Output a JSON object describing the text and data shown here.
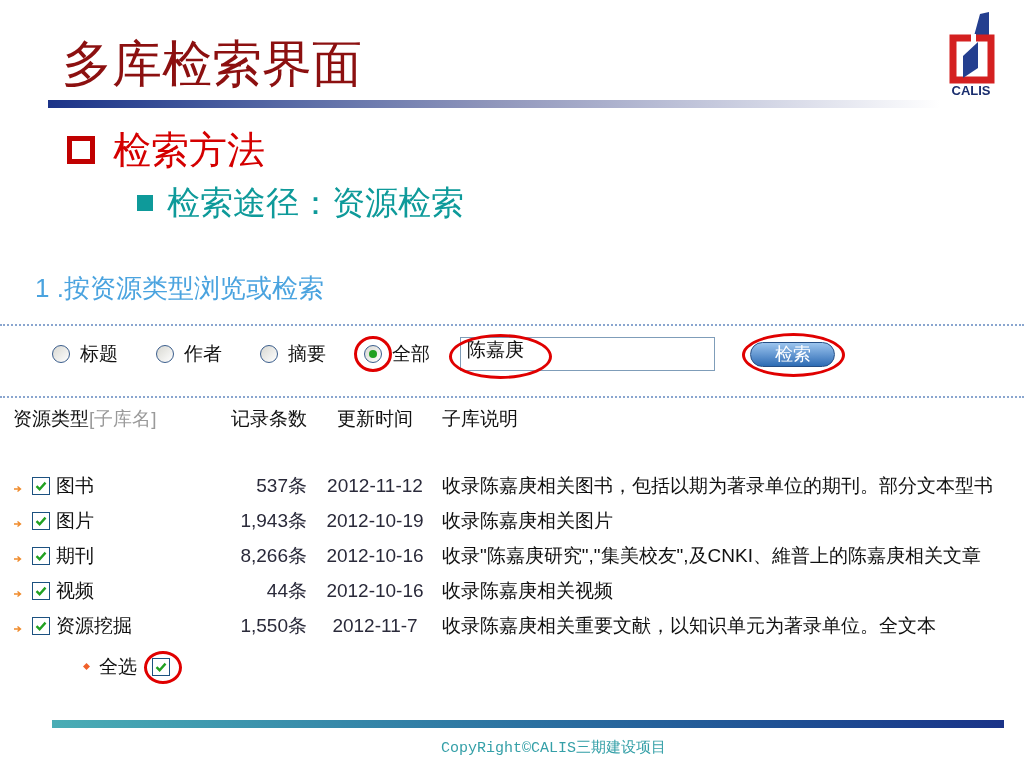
{
  "slide": {
    "title": "多库检索界面",
    "logo_text": "CALIS"
  },
  "bullets": [
    {
      "text": "检索方法",
      "children": [
        {
          "text": "检索途径：资源检索"
        }
      ]
    }
  ],
  "screenshot": {
    "heading": "1 .按资源类型浏览或检索",
    "search_scopes": [
      {
        "label": "标题",
        "selected": false,
        "circled": false
      },
      {
        "label": "作者",
        "selected": false,
        "circled": false
      },
      {
        "label": "摘要",
        "selected": false,
        "circled": false
      },
      {
        "label": "全部",
        "selected": true,
        "circled": true
      }
    ],
    "search_field": {
      "value": "陈嘉庚",
      "circled": true
    },
    "search_button": {
      "label": "检索",
      "circled": true
    },
    "columns": [
      {
        "label": "资源类型",
        "hint": "[子库名]"
      },
      {
        "label": "记录条数"
      },
      {
        "label": "更新时间"
      },
      {
        "label": "子库说明"
      }
    ],
    "rows": [
      {
        "name": "图书",
        "checked": true,
        "count": "537条",
        "updated": "2012-11-12",
        "description": "收录陈嘉庚相关图书，包括以期为著录单位的期刊。部分文本型书"
      },
      {
        "name": "图片",
        "checked": true,
        "count": "1,943条",
        "updated": "2012-10-19",
        "description": "收录陈嘉庚相关图片"
      },
      {
        "name": "期刊",
        "checked": true,
        "count": "8,266条",
        "updated": "2012-10-16",
        "description": "收录\"陈嘉庚研究\",\"集美校友\",及CNKI、維普上的陈嘉庚相关文章"
      },
      {
        "name": "视频",
        "checked": true,
        "count": "44条",
        "updated": "2012-10-16",
        "description": "收录陈嘉庚相关视频"
      },
      {
        "name": "资源挖掘",
        "checked": true,
        "count": "1,550条",
        "updated": "2012-11-7",
        "description": "收录陈嘉庚相关重要文献，以知识单元为著录单位。全文本"
      }
    ],
    "select_all": {
      "label": "全选",
      "checked": true,
      "circled": true
    }
  },
  "footer": {
    "text": "CopyRight©CALIS三期建设项目"
  }
}
